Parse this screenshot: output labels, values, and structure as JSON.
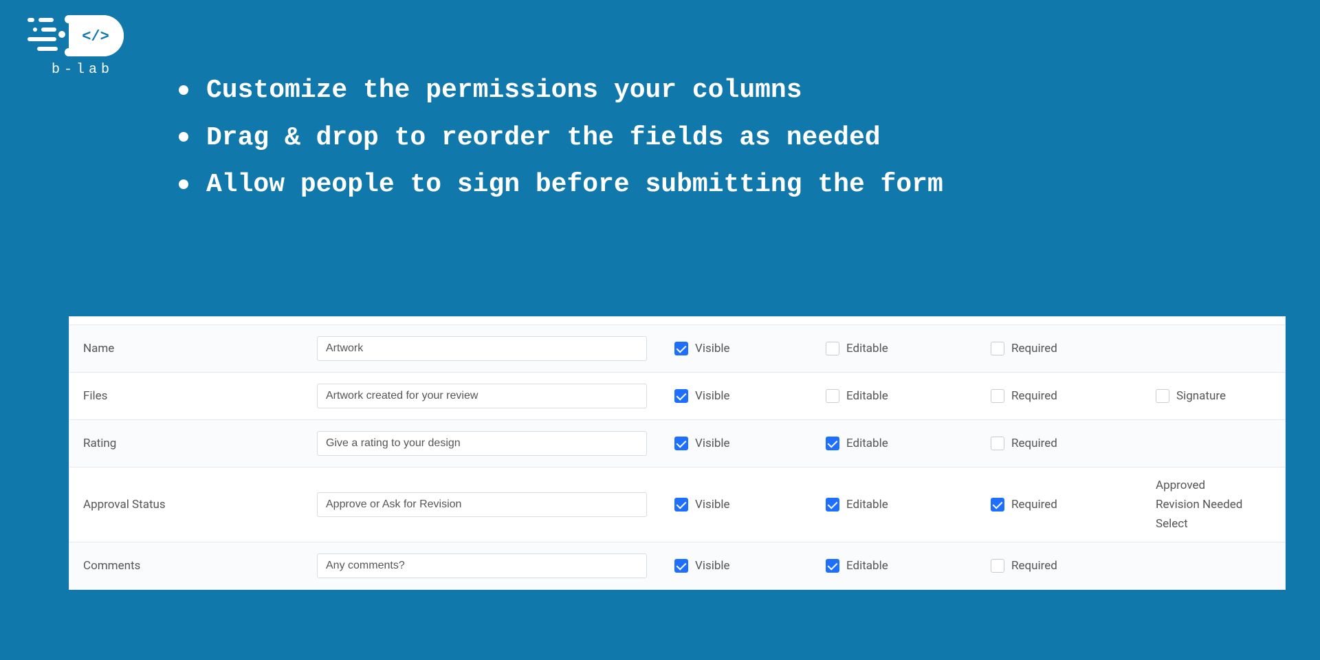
{
  "logo": {
    "text": "b-lab"
  },
  "bullets": [
    "Customize the permissions your columns",
    "Drag & drop to reorder the fields as needed",
    "Allow  people to sign before submitting the form"
  ],
  "labels": {
    "visible": "Visible",
    "editable": "Editable",
    "required": "Required",
    "signature": "Signature"
  },
  "rows": [
    {
      "name": "Name",
      "value": "Artwork",
      "visible": true,
      "editable": false,
      "required": false,
      "extra": {
        "type": "none"
      }
    },
    {
      "name": "Files",
      "value": "Artwork created for your review",
      "visible": true,
      "editable": false,
      "required": false,
      "extra": {
        "type": "signature",
        "checked": false
      }
    },
    {
      "name": "Rating",
      "value": "Give a rating to your design",
      "visible": true,
      "editable": true,
      "required": false,
      "extra": {
        "type": "none"
      }
    },
    {
      "name": "Approval Status",
      "value": "Approve or Ask for Revision",
      "visible": true,
      "editable": true,
      "required": true,
      "extra": {
        "type": "options",
        "options": [
          "Approved",
          "Revision Needed",
          "Select"
        ]
      }
    },
    {
      "name": "Comments",
      "value": "Any comments?",
      "visible": true,
      "editable": true,
      "required": false,
      "extra": {
        "type": "none"
      }
    }
  ]
}
